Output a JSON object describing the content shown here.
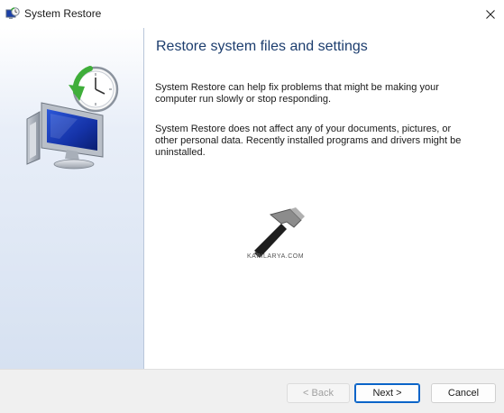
{
  "window": {
    "title": "System Restore"
  },
  "content": {
    "heading": "Restore system files and settings",
    "paragraph1": "System Restore can help fix problems that might be making your computer run slowly or stop responding.",
    "paragraph2": "System Restore does not affect any of your documents, pictures, or other personal data. Recently installed programs and drivers might be uninstalled."
  },
  "watermark": {
    "text": "KAPILARYA.COM"
  },
  "buttons": {
    "back": "< Back",
    "next": "Next >",
    "cancel": "Cancel"
  },
  "icons": {
    "title": "system-restore-icon",
    "hero": "system-restore-monitor-clock-icon",
    "watermark": "hammer-icon",
    "close": "close-icon"
  },
  "colors": {
    "heading": "#1c3d6e",
    "accent_border": "#0a64c8",
    "left_panel": "#d6e1f1"
  }
}
